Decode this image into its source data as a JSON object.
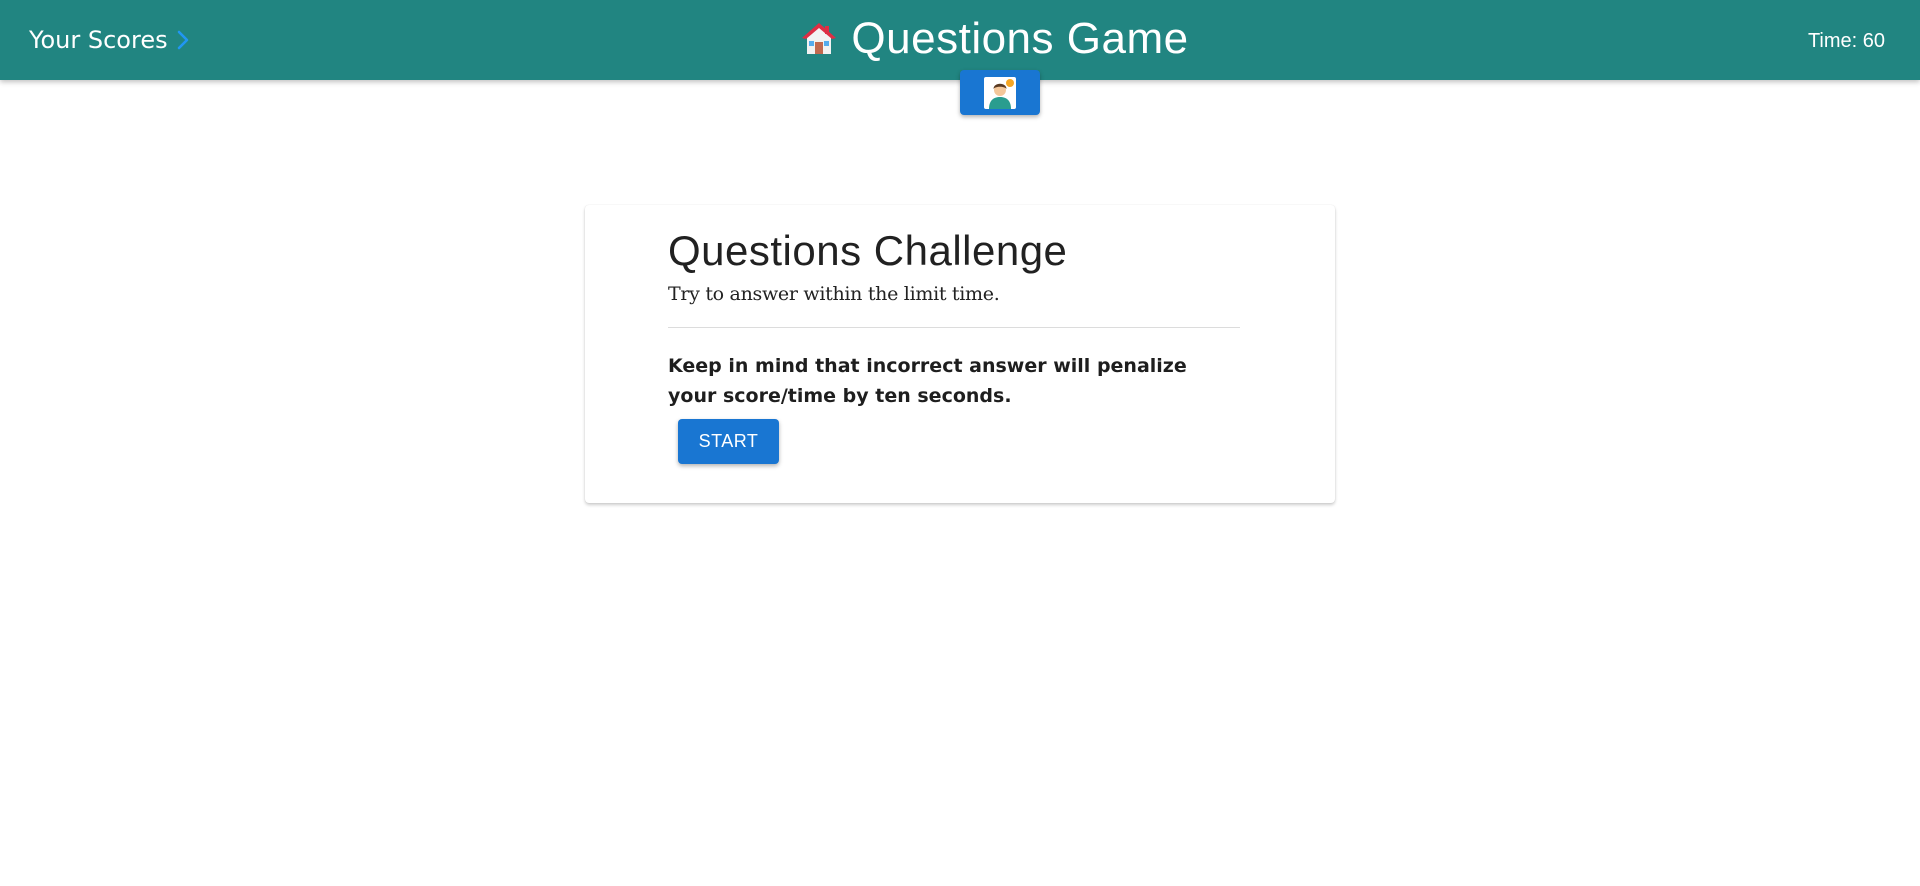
{
  "header": {
    "scores_link": "Your Scores",
    "title": "Questions Game",
    "timer": "Time: 60",
    "home_icon": "house-emoji-icon",
    "avatar_icon": "user-avatar-icon"
  },
  "card": {
    "title": "Questions Challenge",
    "subtitle": "Try to answer within the limit time.",
    "warning": "Keep in mind that incorrect answer will penalize your score/time by ten seconds.",
    "start_label": "START"
  },
  "colors": {
    "header_bg": "#218581",
    "button_bg": "#1976d2",
    "chevron": "#2196f3"
  }
}
